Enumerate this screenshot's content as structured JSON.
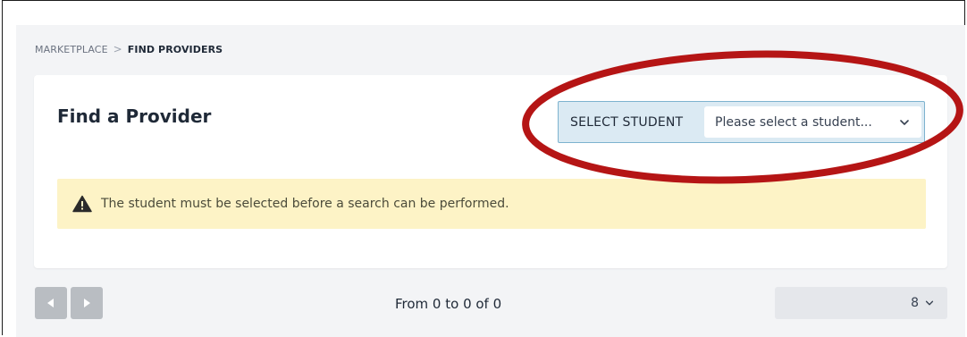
{
  "breadcrumb": {
    "items": [
      "MARKETPLACE",
      "FIND PROVIDERS"
    ],
    "separator": ">"
  },
  "header": {
    "title": "Find a Provider"
  },
  "student_select": {
    "label": "SELECT STUDENT",
    "placeholder": "Please select a student..."
  },
  "alert": {
    "icon": "warning-icon",
    "message": "The student must be selected before a search can be performed."
  },
  "pagination": {
    "prev_icon": "triangle-left-icon",
    "next_icon": "triangle-right-icon",
    "range_text": "From 0 to 0 of 0",
    "page_size": "8"
  },
  "colors": {
    "annotation_red": "#b51515",
    "alert_bg": "#fdf3c6",
    "select_bg": "#dbeaf3",
    "select_border": "#7db3cf"
  }
}
